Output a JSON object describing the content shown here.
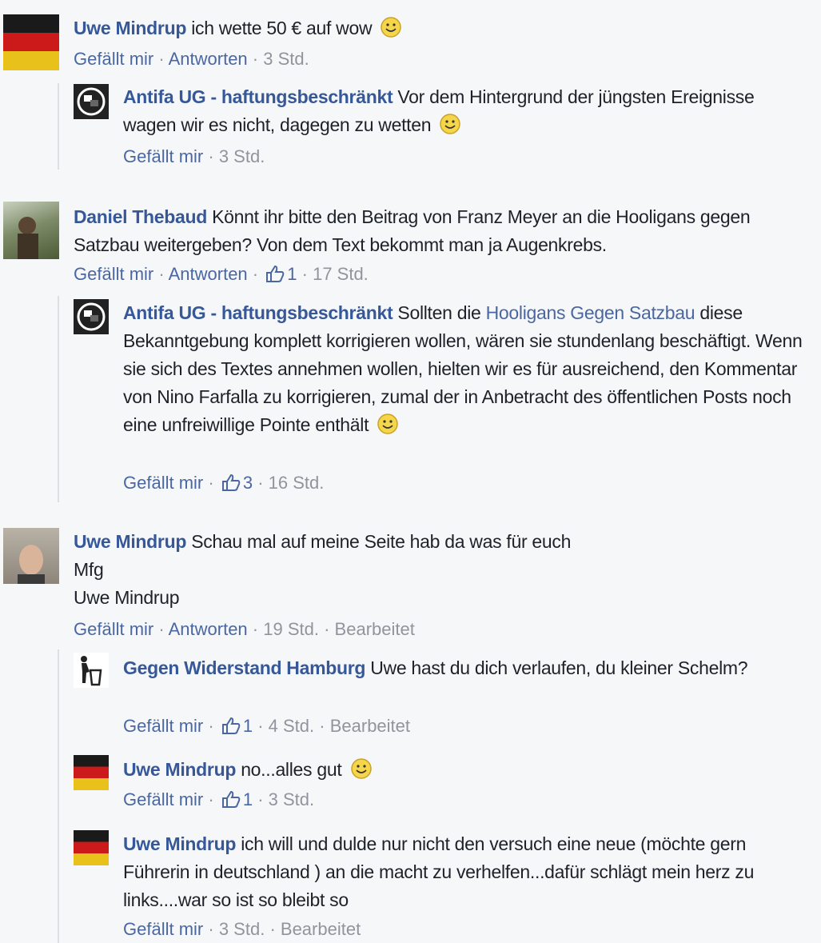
{
  "comments": [
    {
      "author": "Uwe Mindrup",
      "text": "ich wette 50 € auf wow",
      "like": "Gefällt mir",
      "reply": "Antworten",
      "time": "3 Std."
    },
    {
      "author": "Antifa UG - haftungsbeschränkt",
      "text": "Vor dem Hintergrund der jüngsten Ereignisse wagen wir es nicht, dagegen zu wetten",
      "like": "Gefällt mir",
      "time": "3 Std."
    },
    {
      "author": "Daniel Thebaud",
      "text": "Könnt ihr bitte den Beitrag von Franz Meyer an die Hooligans gegen Satzbau weitergeben? Von dem Text bekommt man ja Augenkrebs.",
      "like": "Gefällt mir",
      "reply": "Antworten",
      "likes": "1",
      "time": "17 Std."
    },
    {
      "author": "Antifa UG - haftungsbeschränkt",
      "text_before": "Sollten die",
      "link": "Hooligans Gegen Satzbau",
      "text": "diese Bekanntgebung komplett korrigieren wollen, wären sie stundenlang beschäftigt. Wenn sie sich des Textes annehmen wollen, hielten wir es für ausreichend, den Kommentar von Nino Farfalla zu korrigieren, zumal der in Anbetracht des öffentlichen Posts noch eine unfreiwillige Pointe enthält",
      "like": "Gefällt mir",
      "likes": "3",
      "time": "16 Std."
    },
    {
      "author": "Uwe Mindrup",
      "text": "Schau mal auf meine Seite hab da was für euch",
      "line2": "Mfg",
      "line3": "Uwe Mindrup",
      "like": "Gefällt mir",
      "reply": "Antworten",
      "time": "19 Std.",
      "edited": "Bearbeitet"
    },
    {
      "author": "Gegen Widerstand Hamburg",
      "text": "Uwe hast du dich verlaufen, du kleiner Schelm?",
      "like": "Gefällt mir",
      "likes": "1",
      "time": "4 Std.",
      "edited": "Bearbeitet"
    },
    {
      "author": "Uwe Mindrup",
      "text": "no...alles gut",
      "like": "Gefällt mir",
      "likes": "1",
      "time": "3 Std."
    },
    {
      "author": "Uwe Mindrup",
      "text": "ich will und dulde nur nicht den versuch eine neue (möchte gern Führerin in deutschland ) an die macht zu verhelfen...dafür schlägt mein herz zu links....war so ist so bleibt so",
      "like": "Gefällt mir",
      "time": "3 Std.",
      "edited": "Bearbeitet"
    }
  ],
  "sep": "·",
  "icons": {
    "like": "thumbs-up-icon",
    "smiley": "smiley-icon"
  }
}
